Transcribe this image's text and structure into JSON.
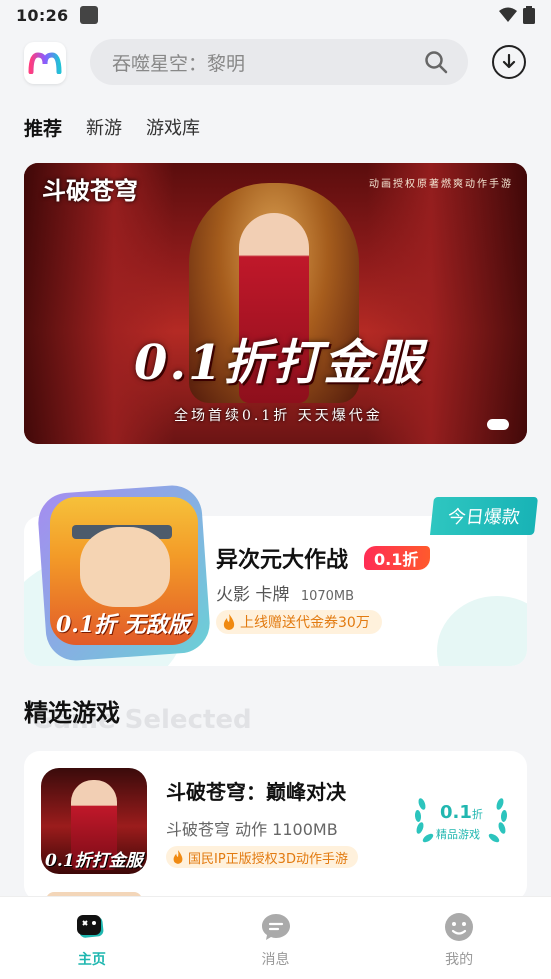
{
  "status": {
    "time": "10:26"
  },
  "search": {
    "placeholder": "吞噬星空：黎明"
  },
  "tabs": [
    {
      "label": "推荐",
      "active": true
    },
    {
      "label": "新游",
      "active": false
    },
    {
      "label": "游戏库",
      "active": false
    }
  ],
  "banner": {
    "logo_text": "斗破苍穹",
    "tagline": "动画授权原著燃爽动作手游",
    "headline": "0.1折打金服",
    "subline": "全场首续0.1折 天天爆代金"
  },
  "featured": {
    "badge": "今日爆款",
    "title": "异次元大作战",
    "discount": "0.1折",
    "tags": "火影 卡牌",
    "size": "1070MB",
    "promo": "上线赠送代金券30万",
    "icon_caption": "0.1折 无敌版"
  },
  "section": {
    "title": "精选游戏",
    "ghost": "Game Selected"
  },
  "games": [
    {
      "title": "斗破苍穹：巅峰对决",
      "tags": "斗破苍穹 动作 1100MB",
      "promo": "国民IP正版授权3D动作手游",
      "icon_caption": "0.1折打金服",
      "discount_num": "0.1",
      "discount_unit": "折",
      "badge_label": "精品游戏"
    }
  ],
  "nav": [
    {
      "label": "主页",
      "icon": "home-gamepad-icon",
      "active": true
    },
    {
      "label": "消息",
      "icon": "message-icon",
      "active": false
    },
    {
      "label": "我的",
      "icon": "profile-icon",
      "active": false
    }
  ],
  "colors": {
    "accent": "#1fb7b0",
    "discount": "#ff2d55",
    "promo": "#e27a10"
  }
}
